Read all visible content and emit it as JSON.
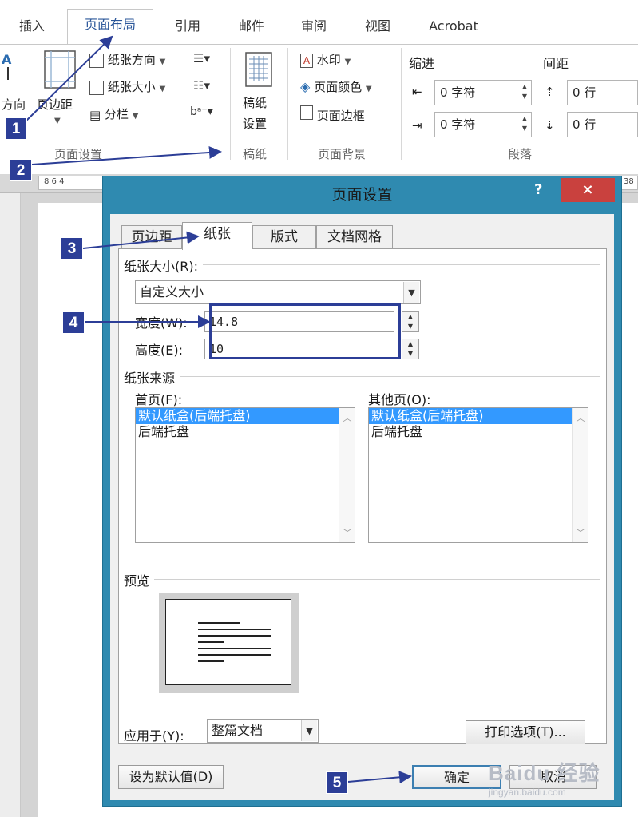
{
  "ribbon": {
    "tabs": [
      "插入",
      "页面布局",
      "引用",
      "邮件",
      "审阅",
      "视图",
      "Acrobat"
    ],
    "active_tab": "页面布局",
    "page_setup_group": {
      "label": "页面设置",
      "direction_label": "方向",
      "margins_label": "页边距",
      "orientation": "纸张方向",
      "size": "纸张大小",
      "columns": "分栏"
    },
    "draft_group": {
      "label": "稿纸",
      "button_line1": "稿纸",
      "button_line2": "设置"
    },
    "background_group": {
      "label": "页面背景",
      "watermark": "水印",
      "page_color": "页面颜色",
      "page_border": "页面边框"
    },
    "paragraph_group": {
      "label": "段落",
      "indent_title": "缩进",
      "spacing_title": "间距",
      "indent_left": "0 字符",
      "indent_right": "0 字符",
      "spacing_before": "0 行",
      "spacing_after": "0 行"
    }
  },
  "ruler": {
    "left_numbers": "8  6  4",
    "right_number": "38"
  },
  "dialog": {
    "title": "页面设置",
    "help": "?",
    "close": "×",
    "tabs": [
      "页边距",
      "纸张",
      "版式",
      "文档网格"
    ],
    "active_tab": "纸张",
    "paper_size_label": "纸张大小(R):",
    "paper_size_value": "自定义大小",
    "width_label": "宽度(W):",
    "width_value": "14.8",
    "height_label": "高度(E):",
    "height_value": "10",
    "paper_source_label": "纸张来源",
    "first_page_label": "首页(F):",
    "other_pages_label": "其他页(O):",
    "first_page_options": [
      "默认纸盒(后端托盘)",
      "后端托盘"
    ],
    "other_pages_options": [
      "默认纸盒(后端托盘)",
      "后端托盘"
    ],
    "preview_label": "预览",
    "apply_to_label": "应用于(Y):",
    "apply_to_value": "整篇文档",
    "print_options_button": "打印选项(T)...",
    "set_default_button": "设为默认值(D)",
    "ok_button": "确定",
    "cancel_button": "取消"
  },
  "callouts": [
    "1",
    "2",
    "3",
    "4",
    "5"
  ],
  "watermark": {
    "main": "Baidu 经验",
    "sub": "jingyan.baidu.com"
  },
  "colors": {
    "dialog_frame": "#2f8ab0",
    "close_button": "#c9413e",
    "callout": "#2c3e97",
    "selection": "#3399ff"
  }
}
